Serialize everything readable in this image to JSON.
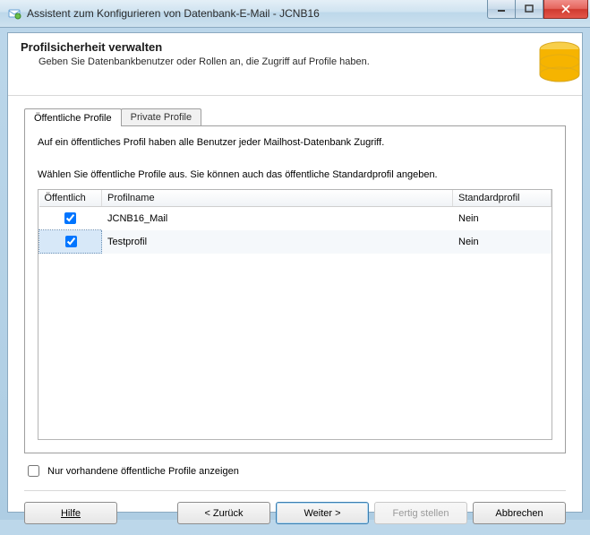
{
  "window": {
    "title": "Assistent zum Konfigurieren von Datenbank-E-Mail - JCNB16"
  },
  "header": {
    "title": "Profilsicherheit verwalten",
    "subtitle": "Geben Sie Datenbankbenutzer oder Rollen an, die Zugriff auf Profile haben."
  },
  "tabs": {
    "public": "Öffentliche Profile",
    "private": "Private Profile"
  },
  "publicTab": {
    "desc1": "Auf ein öffentliches Profil haben alle Benutzer jeder Mailhost-Datenbank Zugriff.",
    "desc2": "Wählen Sie öffentliche Profile aus. Sie können auch das öffentliche Standardprofil angeben.",
    "columns": {
      "public": "Öffentlich",
      "profileName": "Profilname",
      "defaultProfile": "Standardprofil"
    },
    "rows": [
      {
        "public": true,
        "name": "JCNB16_Mail",
        "default": "Nein",
        "selected": false
      },
      {
        "public": true,
        "name": "Testprofil",
        "default": "Nein",
        "selected": true
      }
    ],
    "filterLabel": "Nur vorhandene öffentliche Profile anzeigen",
    "filterChecked": false
  },
  "buttons": {
    "help": "Hilfe",
    "back": "< Zurück",
    "next": "Weiter >",
    "finish": "Fertig stellen",
    "cancel": "Abbrechen"
  },
  "colors": {
    "accent": "#f6b400",
    "defaultButtonBorder": "#3c7fb1"
  }
}
